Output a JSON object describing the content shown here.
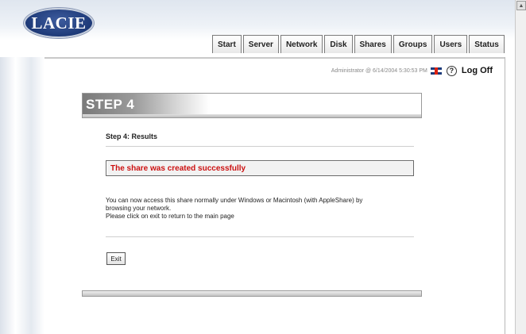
{
  "brand": {
    "logo_text": "LACIE"
  },
  "tabs": [
    {
      "label": "Start"
    },
    {
      "label": "Server"
    },
    {
      "label": "Network"
    },
    {
      "label": "Disk"
    },
    {
      "label": "Shares"
    },
    {
      "label": "Groups"
    },
    {
      "label": "Users"
    },
    {
      "label": "Status"
    }
  ],
  "userbar": {
    "user_info": "Administrator @ 6/14/2004 5:30:53 PM",
    "flag_icon": "uk-flag-icon",
    "help_icon": "help-icon",
    "help_glyph": "?",
    "logoff_label": "Log Off"
  },
  "step": {
    "title": "STEP 4",
    "subtitle": "Step 4: Results"
  },
  "result": {
    "message": "The share was created successfully",
    "message_color": "#cc1111"
  },
  "description": {
    "line1": "You can now access this share normally under Windows or Macintosh (with AppleShare) by",
    "line2": "browsing your network.",
    "line3": "Please click on exit to return to the main page"
  },
  "actions": {
    "exit_label": "Exit"
  },
  "scrollbar": {
    "up_icon": "scroll-up-arrow-icon",
    "up_glyph": "▲"
  }
}
